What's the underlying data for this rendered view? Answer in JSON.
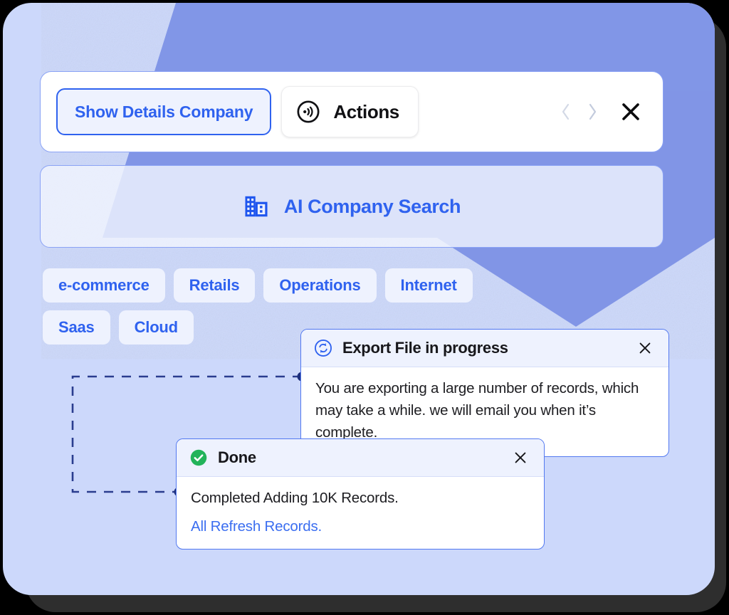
{
  "theme": {
    "brand_blue": "#2f62ef",
    "panel_bg": "#ccd8fb",
    "deco_blue": "#7e93e6",
    "chip_bg": "#eef2fe",
    "success_green": "#22b35a",
    "shadow_dark": "#2e2e2e",
    "connector_navy": "#2a3d8f"
  },
  "toolbar": {
    "show_details_label": "Show Details Company",
    "actions_label": "Actions",
    "actions_icon": "broadcast-circle-icon",
    "prev_icon": "chevron-left-icon",
    "next_icon": "chevron-right-icon",
    "close_icon": "close-icon"
  },
  "search": {
    "label": "AI Company Search",
    "icon": "building-icon"
  },
  "tags": [
    {
      "label": "e-commerce"
    },
    {
      "label": "Retails"
    },
    {
      "label": "Operations"
    },
    {
      "label": "Internet"
    },
    {
      "label": "Saas"
    },
    {
      "label": "Cloud"
    }
  ],
  "notifications": [
    {
      "id": "export",
      "title": "Export File in progress",
      "icon": "sync-circle-icon",
      "close_icon": "close-icon",
      "body": "You are exporting a large number of records, which may take a while. we will email you when it’s complete.",
      "link": null
    },
    {
      "id": "done",
      "title": "Done",
      "icon": "check-circle-icon",
      "close_icon": "close-icon",
      "body": "Completed Adding 10K Records.",
      "link": "All Refresh Records."
    }
  ]
}
